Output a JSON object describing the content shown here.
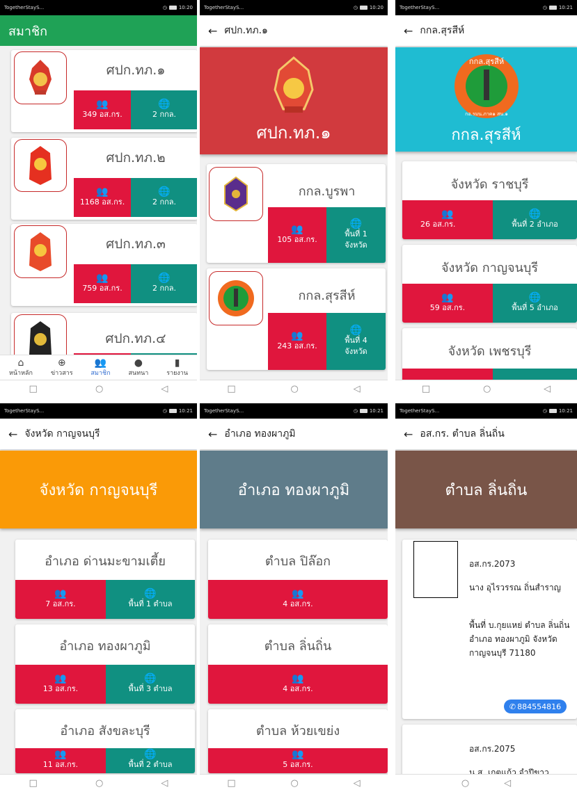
{
  "status": {
    "carrier": "TogetherStayS...",
    "t1": "10:20",
    "t2": "10:21"
  },
  "sys": {
    "square": "□",
    "circle": "○",
    "triangle": "◁"
  },
  "s1": {
    "title": "สมาชิก",
    "cards": [
      {
        "name": "ศปก.ทภ.๑",
        "members": "349 อส.กร.",
        "areas": "2 กกล."
      },
      {
        "name": "ศปก.ทภ.๒",
        "members": "1168 อส.กร.",
        "areas": "2 กกล."
      },
      {
        "name": "ศปก.ทภ.๓",
        "members": "759 อส.กร.",
        "areas": "2 กกล."
      },
      {
        "name": "ศปก.ทภ.๔"
      }
    ],
    "nav": [
      {
        "label": "หน้าหลัก",
        "icon": "⌂"
      },
      {
        "label": "ข่าวสาร",
        "icon": "⊕"
      },
      {
        "label": "สมาชิก",
        "icon": "👥"
      },
      {
        "label": "สนทนา",
        "icon": "●"
      },
      {
        "label": "รายงาน",
        "icon": "▮"
      }
    ]
  },
  "s2": {
    "title": "ศปก.ทภ.๑",
    "hero": "ศปก.ทภ.๑",
    "cards": [
      {
        "name": "กกล.บูรพา",
        "members": "105 อส.กร.",
        "area1": "พื้นที่ 1",
        "area2": "จังหวัด"
      },
      {
        "name": "กกล.สุรสีห์",
        "members": "243 อส.กร.",
        "area1": "พื้นที่ 4",
        "area2": "จังหวัด"
      }
    ]
  },
  "s3": {
    "title": "กกล.สุรสีห์",
    "hero": "กกล.สุรสีห์",
    "logo_top": "กกล.สุรสีห์",
    "logo_bottom": "กอ.รมน.ภาค๑ สน.๑",
    "cards": [
      {
        "name": "จังหวัด ราชบุรี",
        "members": "26 อส.กร.",
        "areas": "พื้นที่ 2 อำเภอ"
      },
      {
        "name": "จังหวัด กาญจนบุรี",
        "members": "59 อส.กร.",
        "areas": "พื้นที่ 5 อำเภอ"
      },
      {
        "name": "จังหวัด เพชรบุรี"
      }
    ]
  },
  "s4": {
    "title": "จังหวัด กาญจนบุรี",
    "hero": "จังหวัด กาญจนบุรี",
    "cards": [
      {
        "name": "อำเภอ ด่านมะขามเตี้ย",
        "members": "7 อส.กร.",
        "areas": "พื้นที่ 1 ตำบล"
      },
      {
        "name": "อำเภอ ทองผาภูมิ",
        "members": "13 อส.กร.",
        "areas": "พื้นที่ 3 ตำบล"
      },
      {
        "name": "อำเภอ สังขละบุรี",
        "members": "11 อส.กร.",
        "areas": "พื้นที่ 2 ตำบล"
      }
    ]
  },
  "s5": {
    "title": "อำเภอ ทองผาภูมิ",
    "hero": "อำเภอ ทองผาภูมิ",
    "cards": [
      {
        "name": "ตำบล ปิล๊อก",
        "members": "4 อส.กร."
      },
      {
        "name": "ตำบล ลิ่นถิ่น",
        "members": "4 อส.กร."
      },
      {
        "name": "ตำบล ห้วยเขย่ง",
        "members": "5 อส.กร."
      }
    ]
  },
  "s6": {
    "title": "อส.กร. ตำบล ลิ่นถิ่น",
    "hero": "ตำบล ลิ่นถิ่น",
    "p1": {
      "id": "อส.กร.2073",
      "name": "นาง อุไรวรรณ ถิ่นสำราญ",
      "addr": "พื้นที่ บ.กุยแหย่ ตำบล ลิ่นถิ่น อำเภอ ทองผาภูมิ จังหวัด กาญจนบุรี 71180",
      "phone": "884554816"
    },
    "p2": {
      "id": "อส.กร.2075",
      "name": "น.ส. เกตุแก้ว จำปีขาว"
    }
  },
  "colors": {
    "green": "#1fa256",
    "red": "#e0163d",
    "teal": "#109081",
    "crimson": "#d13a3e",
    "cyan": "#1fbcd2",
    "orange": "#fa9a07",
    "slate": "#5f7c8a",
    "brown": "#795548"
  }
}
